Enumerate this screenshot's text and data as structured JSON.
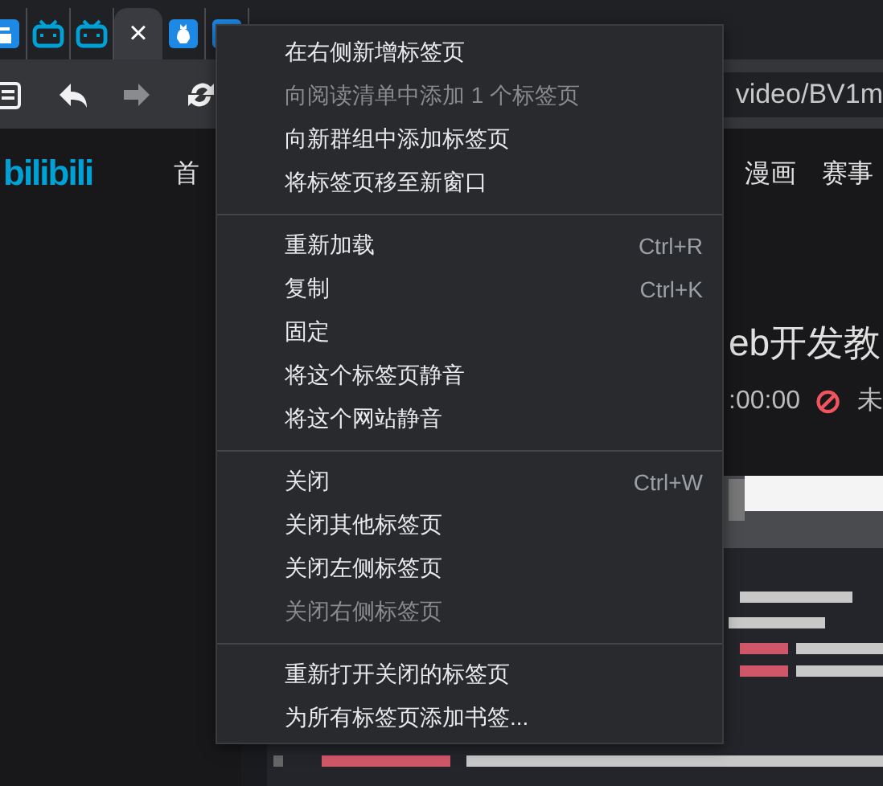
{
  "tabs": [
    {
      "kind": "blue",
      "selected": false
    },
    {
      "kind": "tv",
      "selected": false
    },
    {
      "kind": "tv",
      "selected": false
    },
    {
      "kind": "close",
      "selected": true,
      "glyph": "×"
    },
    {
      "kind": "bird",
      "selected": false
    },
    {
      "kind": "blue",
      "selected": false
    }
  ],
  "toolbar": {
    "buttons": [
      {
        "kind": "page",
        "disabled": false
      },
      {
        "kind": "back",
        "disabled": false
      },
      {
        "kind": "forward",
        "disabled": true
      },
      {
        "kind": "reload",
        "disabled": false
      }
    ],
    "address": "video/BV1m"
  },
  "page": {
    "logo": "bilibili",
    "nav": [
      "首",
      "漫画",
      "赛事"
    ],
    "video_title": "eb开发教",
    "time": ":00:00",
    "status": "未",
    "video": {
      "kind": "picture"
    }
  },
  "menu": {
    "groups": [
      [
        {
          "label": "在右侧新增标签页",
          "disabled": false
        },
        {
          "label": "向阅读清单中添加 1 个标签页",
          "disabled": true
        },
        {
          "label": "向新群组中添加标签页",
          "disabled": false
        },
        {
          "label": "将标签页移至新窗口",
          "disabled": false
        }
      ],
      [
        {
          "label": "重新加载",
          "shortcut": "Ctrl+R",
          "disabled": false
        },
        {
          "label": "复制",
          "shortcut": "Ctrl+K",
          "disabled": false
        },
        {
          "label": "固定",
          "disabled": false
        },
        {
          "label": "将这个标签页静音",
          "disabled": false
        },
        {
          "label": "将这个网站静音",
          "disabled": false
        }
      ],
      [
        {
          "label": "关闭",
          "shortcut": "Ctrl+W",
          "disabled": false
        },
        {
          "label": "关闭其他标签页",
          "disabled": false
        },
        {
          "label": "关闭左侧标签页",
          "disabled": false
        },
        {
          "label": "关闭右侧标签页",
          "disabled": true
        }
      ],
      [
        {
          "label": "重新打开关闭的标签页",
          "disabled": false
        },
        {
          "label": "为所有标签页添加书签...",
          "disabled": false
        }
      ]
    ]
  }
}
